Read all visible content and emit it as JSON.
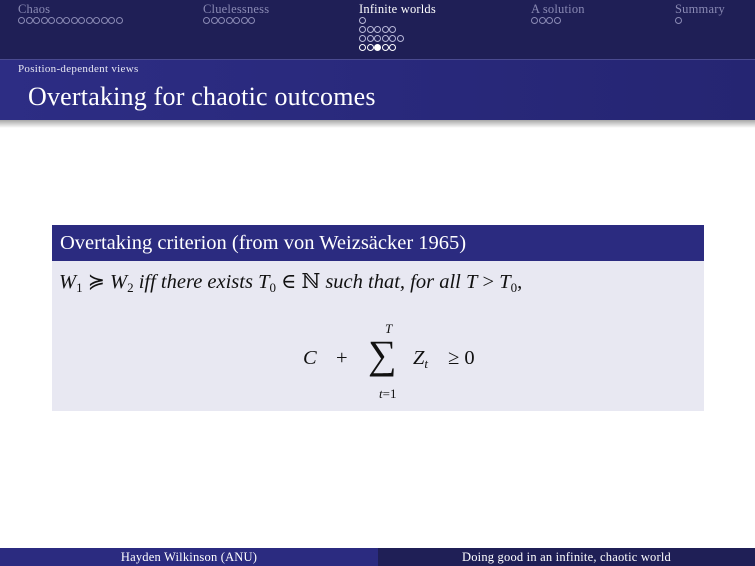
{
  "nav": {
    "sections": [
      {
        "title": "Chaos",
        "active": false,
        "rows": [
          {
            "dots": 14,
            "filled": -1
          }
        ]
      },
      {
        "title": "Cluelessness",
        "active": false,
        "rows": [
          {
            "dots": 7,
            "filled": -1
          }
        ]
      },
      {
        "title": "Infinite worlds",
        "active": true,
        "rows": [
          {
            "dots": 1,
            "filled": -1
          },
          {
            "dots": 5,
            "filled": -1
          },
          {
            "dots": 6,
            "filled": -1
          },
          {
            "dots": 5,
            "filled": 2,
            "current": true
          }
        ]
      },
      {
        "title": "A solution",
        "active": false,
        "rows": [
          {
            "dots": 4,
            "filled": -1
          }
        ]
      },
      {
        "title": "Summary",
        "active": false,
        "rows": [
          {
            "dots": 1,
            "filled": -1
          }
        ]
      }
    ]
  },
  "frame": {
    "subsection": "Position-dependent views",
    "title": "Overtaking for chaotic outcomes"
  },
  "block": {
    "title": "Overtaking criterion (from von Weizsäcker 1965)",
    "statement": {
      "w1": "W",
      "w1_sub": "1",
      "relation": " ≽ ",
      "w2": "W",
      "w2_sub": "2",
      "text1": " iff there exists ",
      "t0": "T",
      "t0_sub": "0",
      "in": " ∈ ",
      "naturals": "ℕ",
      "text2": " such that, for all ",
      "t": "T",
      "gt": " > ",
      "t0b": "T",
      "t0b_sub": "0",
      "end": ","
    },
    "formula": {
      "c": "C",
      "plus": "+",
      "sigma": "∑",
      "upper": "T",
      "lower_var": "t",
      "lower_rest": "=1",
      "z": "Z",
      "z_sub": "t",
      "geq": "≥ 0"
    }
  },
  "footer": {
    "left": "Hayden Wilkinson (ANU)",
    "right": "Doing good in an infinite, chaotic world"
  },
  "colors": {
    "nav_bg": "#1f1f56",
    "frame_title_bg": "#2b2b80",
    "block_head_bg": "#2b2b80",
    "block_body_bg": "#e8e8f2",
    "inactive_text": "#8a8ab4"
  }
}
